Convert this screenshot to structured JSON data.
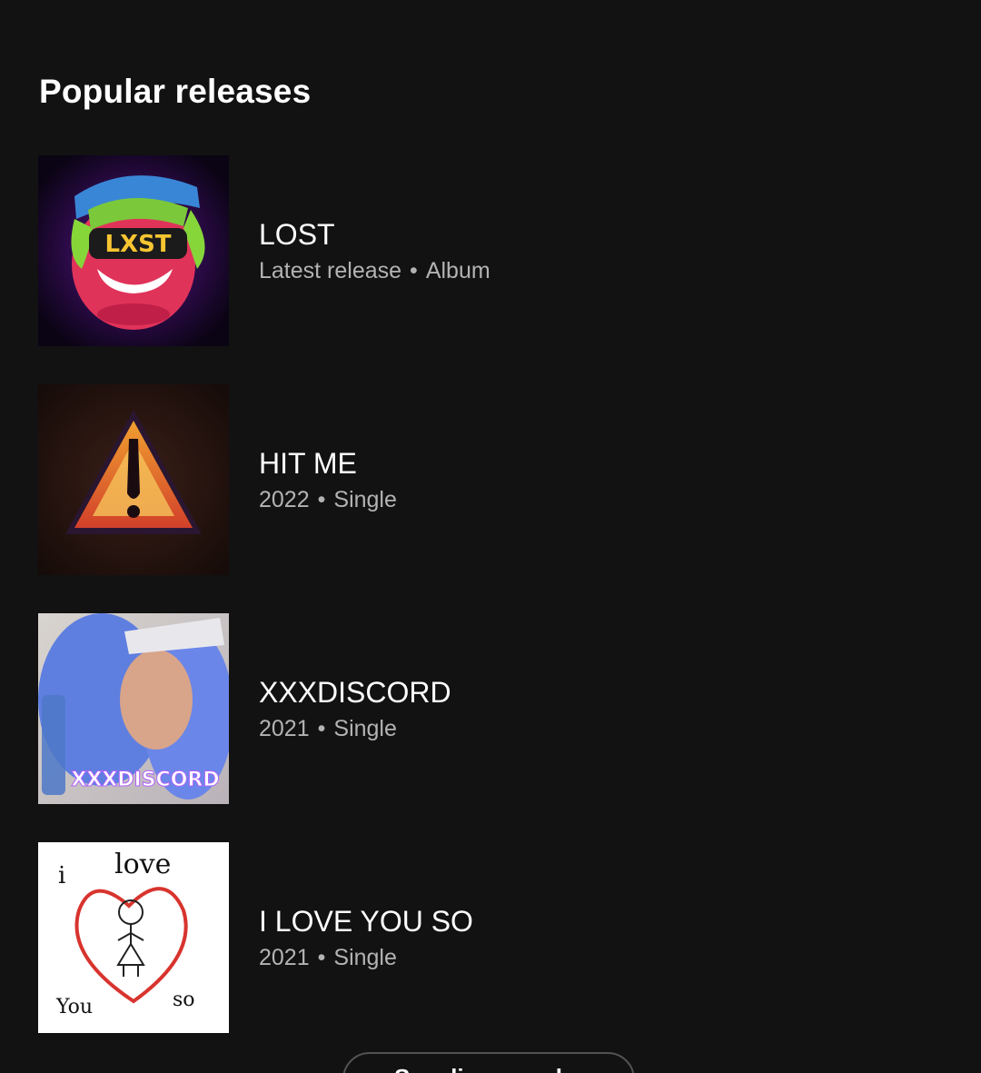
{
  "section": {
    "title": "Popular releases"
  },
  "releases": [
    {
      "title": "LOST",
      "meta_left": "Latest release",
      "meta_right": "Album",
      "cover": "lost-album-cover"
    },
    {
      "title": "HIT ME",
      "meta_left": "2022",
      "meta_right": "Single",
      "cover": "hit-me-cover"
    },
    {
      "title": "XXXDISCORD",
      "meta_left": "2021",
      "meta_right": "Single",
      "cover": "xxxdiscord-cover"
    },
    {
      "title": "I LOVE YOU SO",
      "meta_left": "2021",
      "meta_right": "Single",
      "cover": "i-love-you-so-cover"
    }
  ],
  "covers": {
    "lost_logo": "LXST",
    "xxxdiscord_text": "XXXDISCORD",
    "love_words": {
      "i": "i",
      "love": "love",
      "you": "You",
      "so": "so"
    }
  },
  "separator": "•",
  "button": {
    "label": "See discography"
  },
  "colors": {
    "background": "#121212",
    "text_primary": "#ffffff",
    "text_secondary": "#b3b3b3"
  }
}
